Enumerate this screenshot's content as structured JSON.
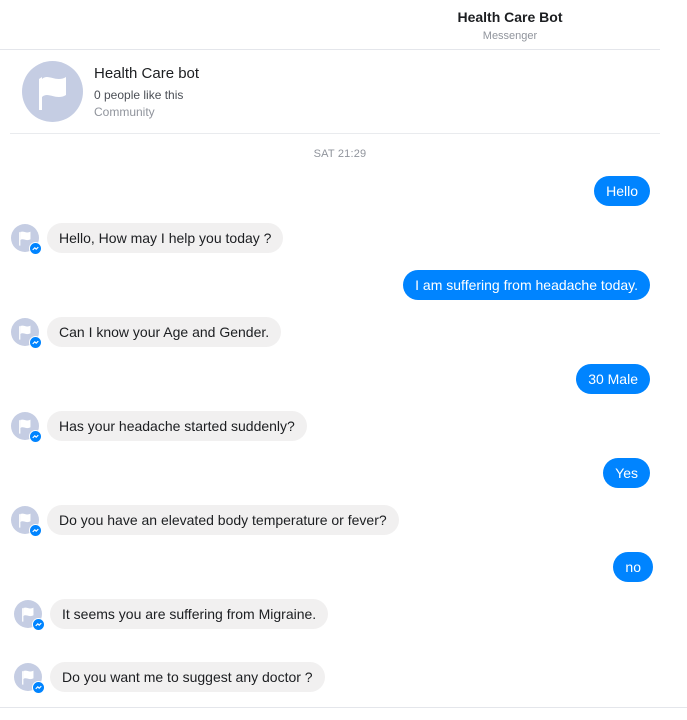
{
  "header": {
    "title": "Health Care Bot",
    "subtitle": "Messenger"
  },
  "page_card": {
    "name": "Health Care bot",
    "likes": "0 people like this",
    "category": "Community"
  },
  "timestamp": "SAT 21:29",
  "messages": [
    {
      "from": "user",
      "text": "Hello"
    },
    {
      "from": "bot",
      "text": "Hello, How may I help you today ?"
    },
    {
      "from": "user",
      "text": "I am suffering from headache today."
    },
    {
      "from": "bot",
      "text": "Can I know your Age and Gender."
    },
    {
      "from": "user",
      "text": "30 Male"
    },
    {
      "from": "bot",
      "text": "Has your headache started suddenly?"
    },
    {
      "from": "user",
      "text": "Yes"
    },
    {
      "from": "bot",
      "text": "Do you have an elevated body temperature or fever?"
    },
    {
      "from": "user",
      "text": "no"
    },
    {
      "from": "bot",
      "text": "It seems you are suffering from Migraine."
    },
    {
      "from": "bot",
      "text": "Do you want me to suggest any doctor ?"
    }
  ],
  "colors": {
    "accent": "#0084ff",
    "incoming_bubble": "#f1f0f0",
    "avatar_bg": "#c5cde3"
  },
  "icons": {
    "page_avatar": "flag-icon",
    "bot_badge": "messenger-icon"
  }
}
